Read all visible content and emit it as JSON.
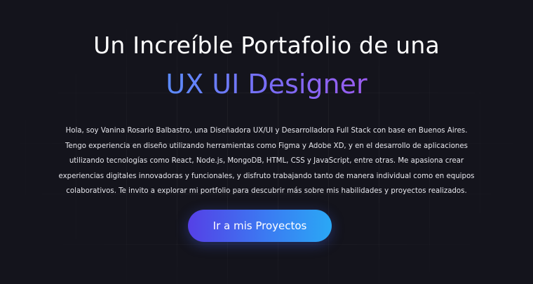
{
  "hero": {
    "title": "Un Increíble Portafolio de una",
    "role": "UX UI Designer",
    "intro": "Hola, soy Vanina Rosario Balbastro, una Diseñadora UX/UI y Desarrolladora Full Stack con base en Buenos Aires. Tengo experiencia en diseño utilizando herramientas como Figma y Adobe XD, y en el desarrollo de aplicaciones utilizando tecnologías como React, Node.js, MongoDB, HTML, CSS y JavaScript, entre otras. Me apasiona crear experiencias digitales innovadoras y funcionales, y disfruto trabajando tanto de manera individual como en equipos colaborativos. Te invito a explorar mi portfolio para descubrir más sobre mis habilidades y proyectos realizados.",
    "cta_label": "Ir a mis Proyectos"
  },
  "colors": {
    "background": "#14141c",
    "role_gradient": [
      "#5b8cff",
      "#7c6bf6",
      "#9b5cf0"
    ],
    "button_gradient": [
      "#5540e6",
      "#3b7bf2",
      "#2aa8f5"
    ]
  }
}
